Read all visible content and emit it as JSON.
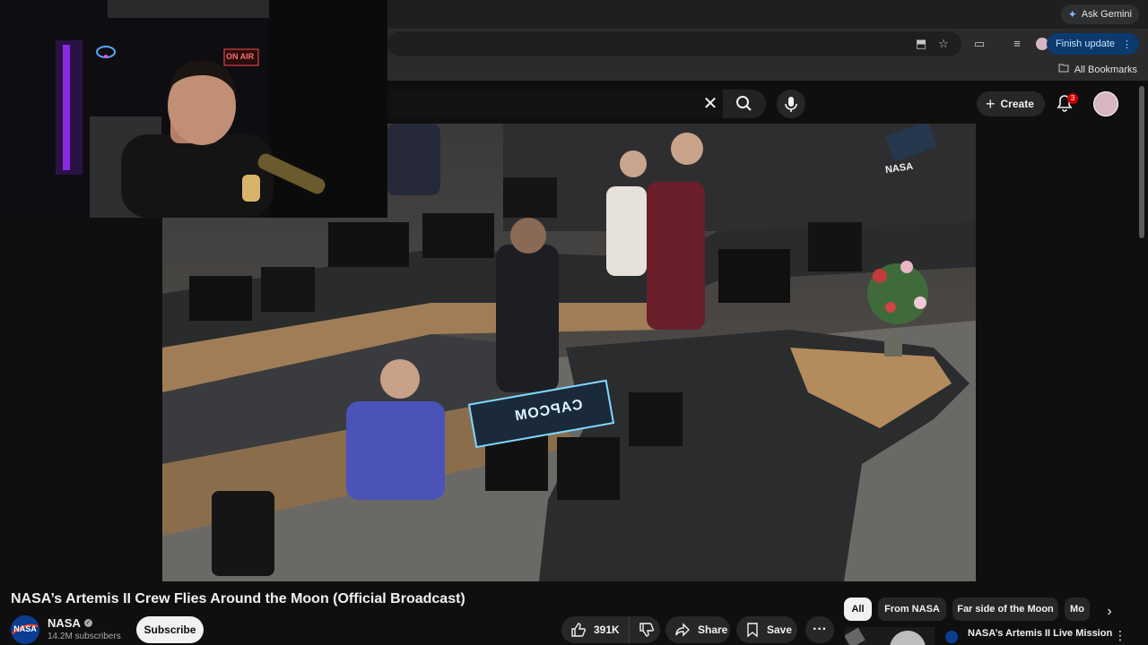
{
  "browser": {
    "ask_gemini_label": "Ask Gemini",
    "finish_update_label": "Finish update",
    "all_bookmarks_label": "All Bookmarks"
  },
  "header": {
    "create_label": "Create",
    "notification_count": "3"
  },
  "webcam": {
    "on_air_sign": "ON AIR"
  },
  "video_overlay": {
    "console_sign": "CAPCOM",
    "screen_label": "NASA"
  },
  "video": {
    "title": "NASA’s Artemis II Crew Flies Around the Moon (Official Broadcast)",
    "channel": {
      "name": "NASA",
      "avatar_text": "NASA",
      "subscribers": "14.2M subscribers",
      "subscribe_label": "Subscribe"
    },
    "actions": {
      "like_count": "391K",
      "share_label": "Share",
      "save_label": "Save"
    }
  },
  "chips": [
    "All",
    "From NASA",
    "Far side of the Moon",
    "Mo"
  ],
  "recommendation": {
    "title": "NASA’s Artemis II Live Mission"
  },
  "colors": {
    "background": "#0f0f0f",
    "finish_update_bg": "#0b3a6e",
    "notification_badge": "#cc0000",
    "neon_purple": "#8a2be2",
    "capcom_sign": "#7fd8ff"
  },
  "icons": [
    "gemini-spark-icon",
    "clear-search-icon",
    "search-icon",
    "mic-icon",
    "plus-icon",
    "bell-icon",
    "thumb-up-icon",
    "thumb-down-icon",
    "share-icon",
    "save-icon",
    "more-icon",
    "chevron-right-icon",
    "verified-icon",
    "folder-icon"
  ]
}
